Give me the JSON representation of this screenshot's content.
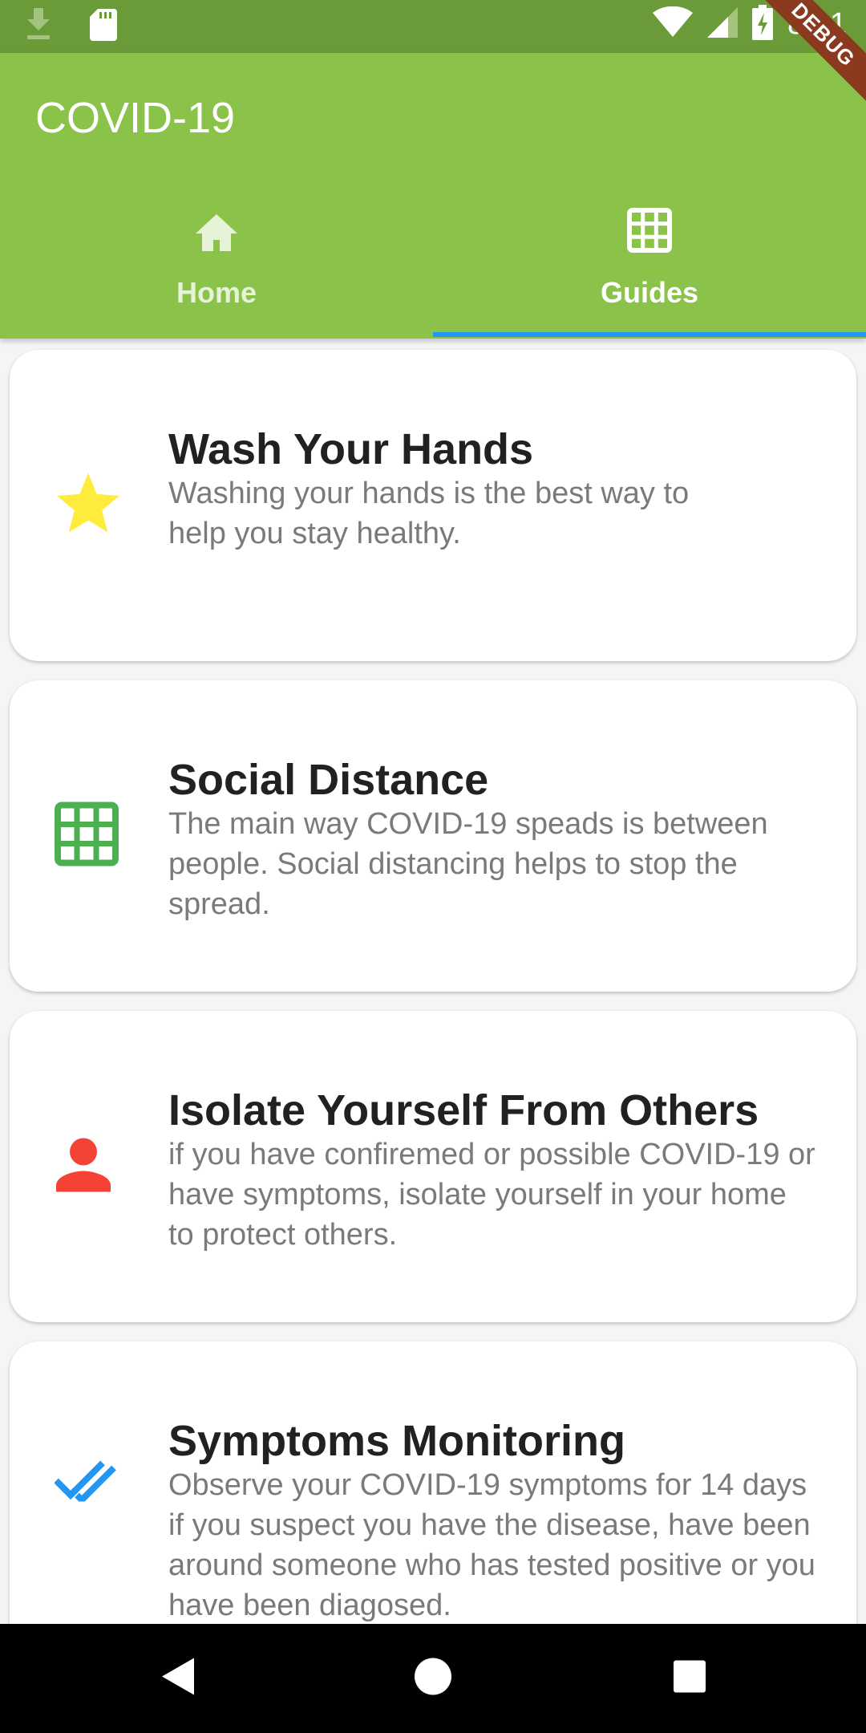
{
  "status_bar": {
    "time": "8:21",
    "icons": [
      "download-icon",
      "sd-card-icon",
      "wifi-icon",
      "signal-icon",
      "battery-charging-icon"
    ]
  },
  "debug_banner": {
    "label": "DEBUG"
  },
  "app_bar": {
    "title": "COVID-19",
    "background": "#8bc34a",
    "tabs": [
      {
        "label": "Home",
        "icon": "home-icon",
        "active": false
      },
      {
        "label": "Guides",
        "icon": "grid-icon",
        "active": true
      }
    ],
    "indicator_color": "#2196f3"
  },
  "guides": [
    {
      "title": "Wash Your Hands",
      "description": "Washing your hands is the best way to\n help you stay healthy.",
      "icon": "star-icon",
      "icon_color": "#ffeb3b"
    },
    {
      "title": "Social Distance",
      "description": "The main way COVID-19 speads is between people. Social distancing helps to stop the spread.",
      "icon": "grid-icon",
      "icon_color": "#4caf50"
    },
    {
      "title": "Isolate Yourself From Others",
      "description": "if you have confiremed or possible COVID-19 or have symptoms, isolate yourself in your home to protect others.",
      "icon": "person-icon",
      "icon_color": "#f44336"
    },
    {
      "title": "Symptoms Monitoring",
      "description": "Observe your COVID-19 symptoms for 14 days if you suspect you have the disease, have been around someone who has tested positive or you have been diagosed.",
      "icon": "double-check-icon",
      "icon_color": "#2196f3"
    }
  ],
  "nav_bar": {
    "buttons": [
      "back-icon",
      "home-circle-icon",
      "recents-icon"
    ]
  }
}
